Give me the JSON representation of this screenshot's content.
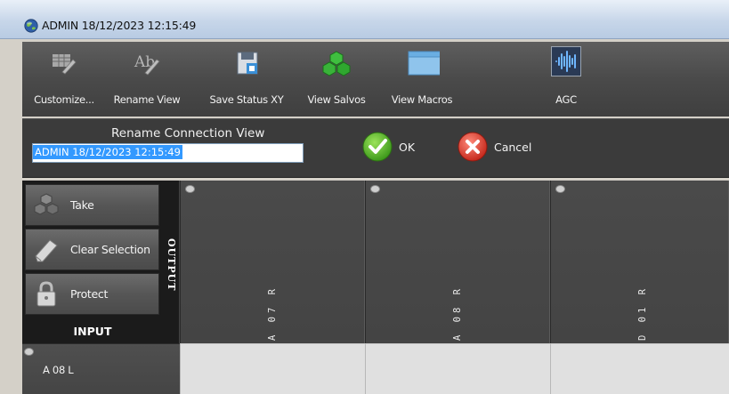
{
  "window": {
    "title": "ADMIN  18/12/2023 12:15:49",
    "icon": "globe-icon"
  },
  "toolbar": {
    "items": [
      {
        "label": "Customize...",
        "icon": "customize-grid-icon"
      },
      {
        "label": "Rename View",
        "icon": "rename-ab-icon"
      },
      {
        "label": "Save Status XY",
        "icon": "save-floppy-icon"
      },
      {
        "label": "View Salvos",
        "icon": "salvos-cubes-icon"
      },
      {
        "label": "View Macros",
        "icon": "macros-window-icon"
      },
      {
        "label": "AGC",
        "icon": "agc-waveform-icon",
        "active": true
      }
    ]
  },
  "rename": {
    "title": "Rename Connection View",
    "value": "ADMIN  18/12/2023 12:15:49",
    "ok_label": "OK",
    "cancel_label": "Cancel"
  },
  "controls": {
    "take_label": "Take",
    "clear_label": "Clear Selection",
    "protect_label": "Protect",
    "output_label": "OUTPUT",
    "input_label": "INPUT"
  },
  "outputs": [
    {
      "label": "A 07 R"
    },
    {
      "label": "A 08 R"
    },
    {
      "label": "D 01 R"
    }
  ],
  "inputs": [
    {
      "label": "A 08 L"
    }
  ],
  "colors": {
    "toolbar_bg": "#4a4a4a",
    "selection": "#3399ff",
    "ok_green": "#5cb82e",
    "cancel_red": "#d93a2b",
    "agc_blue": "#2a3a55"
  }
}
